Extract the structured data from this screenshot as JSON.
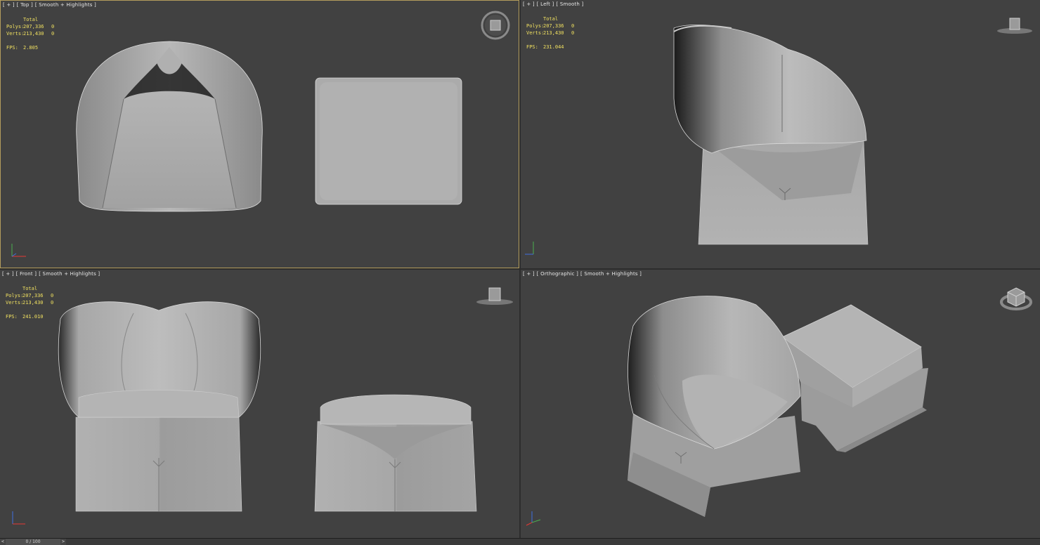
{
  "viewports": {
    "top": {
      "label": [
        "[ + ]",
        "[ Top ]",
        "[ Smooth + Highlights ]"
      ],
      "active": true,
      "stats": {
        "total_label": "Total",
        "polys_label": "Polys:",
        "polys_value": "207,336",
        "polys_sel": "0",
        "verts_label": "Verts:",
        "verts_value": "213,430",
        "verts_sel": "0",
        "fps_label": "FPS:",
        "fps_value": "2.805"
      }
    },
    "left": {
      "label": [
        "[ + ]",
        "[ Left ]",
        "[ Smooth ]"
      ],
      "stats": {
        "total_label": "Total",
        "polys_label": "Polys:",
        "polys_value": "207,336",
        "polys_sel": "0",
        "verts_label": "Verts:",
        "verts_value": "213,430",
        "verts_sel": "0",
        "fps_label": "FPS:",
        "fps_value": "231.044"
      }
    },
    "front": {
      "label": [
        "[ + ]",
        "[ Front ]",
        "[ Smooth + Highlights ]"
      ],
      "stats": {
        "total_label": "Total",
        "polys_label": "Polys:",
        "polys_value": "207,336",
        "polys_sel": "0",
        "verts_label": "Verts:",
        "verts_value": "213,430",
        "verts_sel": "0",
        "fps_label": "FPS:",
        "fps_value": "241.010"
      }
    },
    "perspective": {
      "label": [
        "[ + ]",
        "[ Orthographic ]",
        "[ Smooth + Highlights ]"
      ]
    }
  },
  "timeline": {
    "frame_label": "0 / 100",
    "prev": "<",
    "next": ">"
  },
  "colors": {
    "viewport_bg": "#414141",
    "active_border": "#b39c5d",
    "stats_text": "#f0e060",
    "model_gray": "#a9a9a9"
  }
}
